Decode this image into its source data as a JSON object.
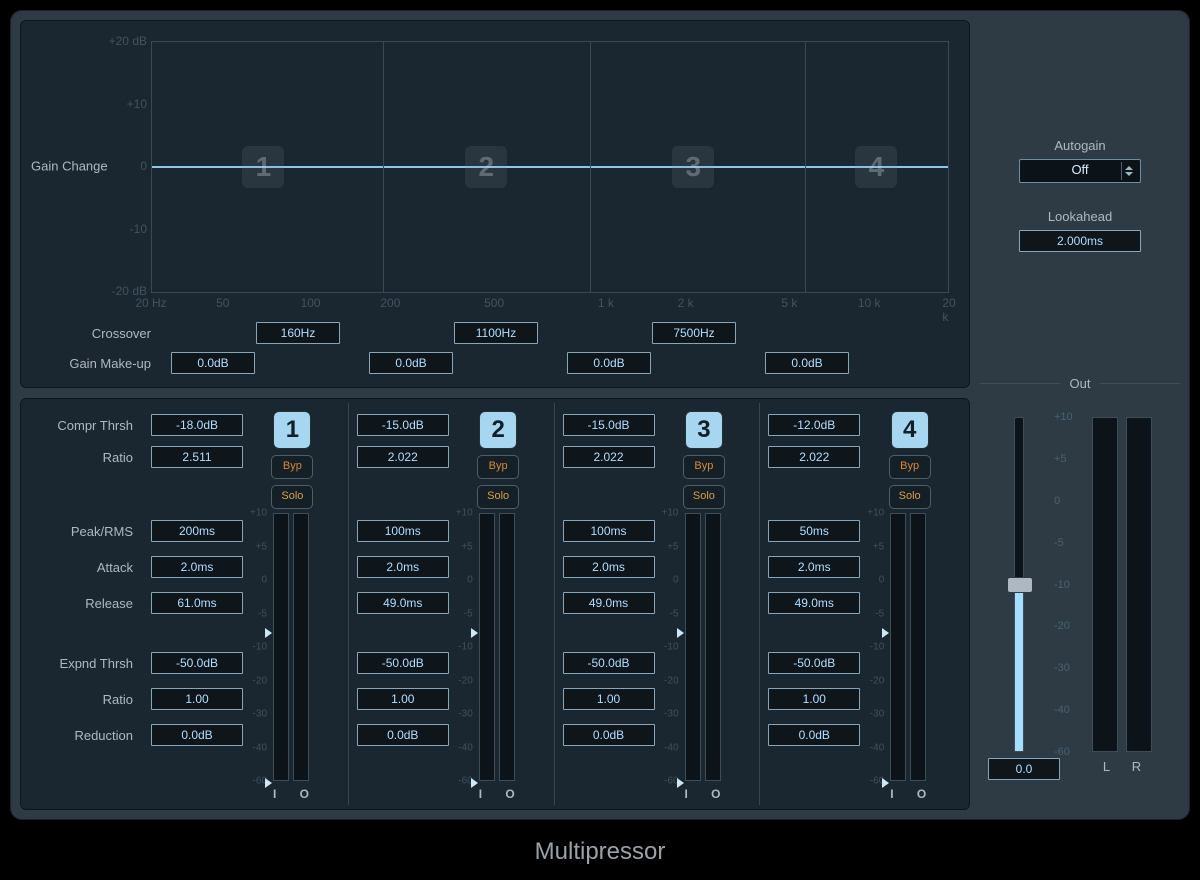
{
  "caption": "Multipressor",
  "graph": {
    "ylabel": "Gain Change",
    "yticks": [
      "+20 dB",
      "+10",
      "0",
      "-10",
      "-20 dB"
    ],
    "xticks": [
      {
        "pos": 0,
        "label": "20 Hz"
      },
      {
        "pos": 9,
        "label": "50"
      },
      {
        "pos": 20,
        "label": "100"
      },
      {
        "pos": 30,
        "label": "200"
      },
      {
        "pos": 43,
        "label": "500"
      },
      {
        "pos": 57,
        "label": "1 k"
      },
      {
        "pos": 67,
        "label": "2 k"
      },
      {
        "pos": 80,
        "label": "5 k"
      },
      {
        "pos": 90,
        "label": "10 k"
      },
      {
        "pos": 100,
        "label": "20 k"
      }
    ],
    "dividers": [
      29,
      55,
      82
    ],
    "badges": [
      "1",
      "2",
      "3",
      "4"
    ],
    "badge_pos": [
      14,
      42,
      68,
      91
    ]
  },
  "under": {
    "crossover_label": "Crossover",
    "crossover": [
      "160Hz",
      "1100Hz",
      "7500Hz"
    ],
    "gainmakeup_label": "Gain Make-up",
    "gainmakeup": [
      "0.0dB",
      "0.0dB",
      "0.0dB",
      "0.0dB"
    ]
  },
  "labels": {
    "compr_thrsh": "Compr Thrsh",
    "ratio": "Ratio",
    "peak_rms": "Peak/RMS",
    "attack": "Attack",
    "release": "Release",
    "expnd_thrsh": "Expnd Thrsh",
    "ratio2": "Ratio",
    "reduction": "Reduction",
    "byp": "Byp",
    "solo": "Solo",
    "io_i": "I",
    "io_o": "O"
  },
  "meter_scale": [
    "+10",
    "+5",
    "0",
    "-5",
    "-10",
    "-20",
    "-30",
    "-40",
    "-60"
  ],
  "bands": [
    {
      "num": "1",
      "compr_thrsh": "-18.0dB",
      "ratio": "2.511",
      "peak_rms": "200ms",
      "attack": "2.0ms",
      "release": "61.0ms",
      "expnd_thrsh": "-50.0dB",
      "ratio2": "1.00",
      "reduction": "0.0dB"
    },
    {
      "num": "2",
      "compr_thrsh": "-15.0dB",
      "ratio": "2.022",
      "peak_rms": "100ms",
      "attack": "2.0ms",
      "release": "49.0ms",
      "expnd_thrsh": "-50.0dB",
      "ratio2": "1.00",
      "reduction": "0.0dB"
    },
    {
      "num": "3",
      "compr_thrsh": "-15.0dB",
      "ratio": "2.022",
      "peak_rms": "100ms",
      "attack": "2.0ms",
      "release": "49.0ms",
      "expnd_thrsh": "-50.0dB",
      "ratio2": "1.00",
      "reduction": "0.0dB"
    },
    {
      "num": "4",
      "compr_thrsh": "-12.0dB",
      "ratio": "2.022",
      "peak_rms": "50ms",
      "attack": "2.0ms",
      "release": "49.0ms",
      "expnd_thrsh": "-50.0dB",
      "ratio2": "1.00",
      "reduction": "0.0dB"
    }
  ],
  "right": {
    "autogain_label": "Autogain",
    "autogain_value": "Off",
    "lookahead_label": "Lookahead",
    "lookahead_value": "2.000ms",
    "out_label": "Out",
    "out_value": "0.0",
    "l": "L",
    "r": "R",
    "out_scale": [
      "+10",
      "+5",
      "0",
      "-5",
      "-10",
      "-20",
      "-30",
      "-40",
      "-60"
    ]
  }
}
